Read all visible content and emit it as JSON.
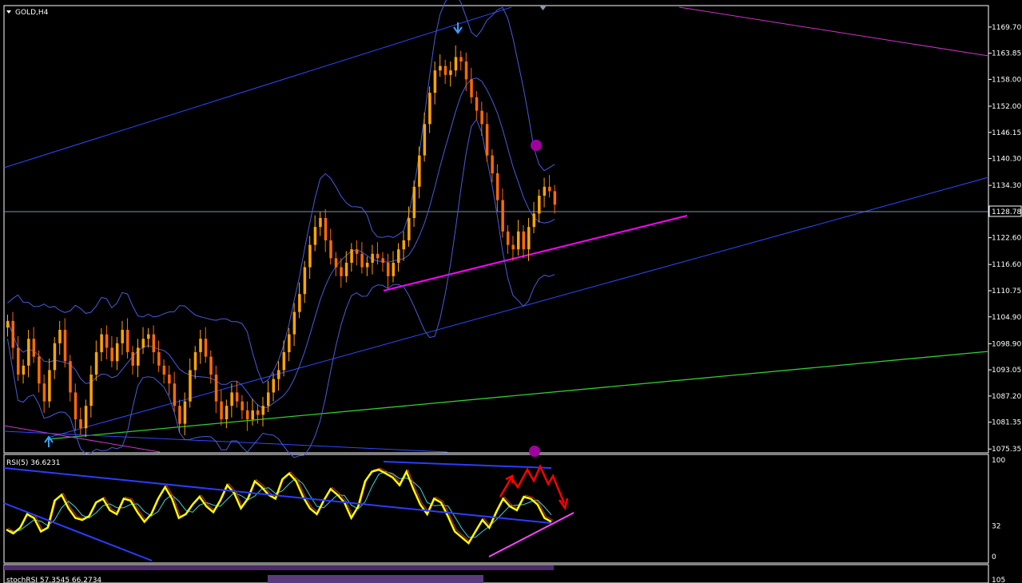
{
  "symbol_title": "GOLD,H4",
  "current_price_label": "1128.78",
  "colors": {
    "background": "#000000",
    "bull_candle": "#ffa500",
    "bear_candle": "#ff6a00",
    "bollinger": "#4a5bd8",
    "channel": "#2f48ff",
    "magenta_line": "#ff00ff",
    "green_line": "#33cc33",
    "rsi_line": "#ffff00",
    "arrow_red": "#ff0000",
    "marker_purple": "#a000a0"
  },
  "chart_data": [
    {
      "type": "line",
      "title": "GOLD,H4",
      "y_ticks": [
        "1169.70",
        "1163.85",
        "1158.00",
        "1152.00",
        "1146.15",
        "1140.30",
        "1134.30",
        "1122.60",
        "1116.60",
        "1110.75",
        "1104.90",
        "1098.90",
        "1093.05",
        "1087.20",
        "1081.35",
        "1075.35"
      ],
      "ylim": [
        1074.5,
        1174.5
      ],
      "current_price": 1128.78,
      "series": [
        {
          "values": [
            1104,
            1098,
            1092,
            1094,
            1100,
            1096,
            1090,
            1086,
            1093,
            1099,
            1102,
            1095,
            1088,
            1082,
            1080,
            1085,
            1092,
            1097,
            1101,
            1098,
            1095,
            1099,
            1102,
            1097,
            1094,
            1098,
            1100,
            1101,
            1097,
            1094,
            1092,
            1090,
            1085,
            1081,
            1086,
            1093,
            1097,
            1100,
            1096,
            1092,
            1086,
            1082,
            1085,
            1088,
            1086,
            1084,
            1082,
            1084,
            1083,
            1085,
            1088,
            1091,
            1093,
            1097,
            1101,
            1106,
            1110,
            1116,
            1121,
            1125,
            1127,
            1122,
            1118,
            1116,
            1114,
            1117,
            1120,
            1119,
            1116,
            1117,
            1119,
            1118,
            1117,
            1114,
            1117,
            1120,
            1122,
            1127,
            1134,
            1141,
            1148,
            1155,
            1160,
            1161,
            1159,
            1160,
            1163,
            1162,
            1158,
            1154,
            1151,
            1148,
            1141,
            1137,
            1131,
            1124,
            1121,
            1120,
            1124,
            1120,
            1125,
            1128,
            1132,
            1134,
            1133,
            1130
          ]
        }
      ]
    },
    {
      "type": "line",
      "title": "RSI(5) 36.6231",
      "y_ticks": [
        "100",
        "32",
        "0"
      ],
      "ylim": [
        0,
        100
      ],
      "series": [
        {
          "values": [
            28,
            24,
            30,
            44,
            40,
            26,
            30,
            58,
            64,
            50,
            40,
            38,
            42,
            56,
            60,
            48,
            44,
            60,
            58,
            46,
            36,
            44,
            60,
            72,
            60,
            40,
            44,
            54,
            62,
            52,
            46,
            58,
            74,
            66,
            50,
            60,
            78,
            72,
            64,
            60,
            80,
            86,
            78,
            62,
            50,
            44,
            58,
            70,
            64,
            56,
            40,
            52,
            78,
            88,
            90,
            86,
            82,
            74,
            88,
            70,
            54,
            44,
            60,
            56,
            42,
            26,
            20,
            14,
            26,
            38,
            30,
            46,
            60,
            52,
            48,
            62,
            60,
            54,
            40,
            36
          ]
        }
      ]
    }
  ],
  "stoch_label": "stochRSI 57.3545 66.2734",
  "stoch_tick": "105"
}
